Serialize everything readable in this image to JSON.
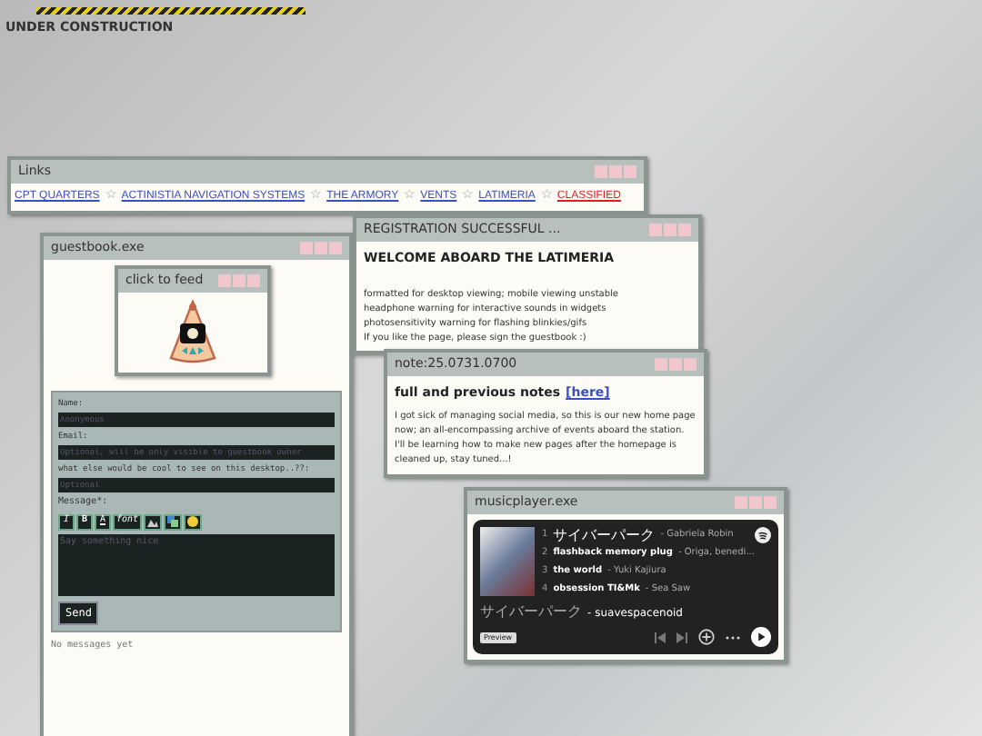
{
  "banner": {
    "text": "UNDER CONSTRUCTION"
  },
  "links_window": {
    "title": "Links",
    "links": [
      {
        "label": "CPT QUARTERS",
        "kind": "normal"
      },
      {
        "label": "ACTINISTIA NAVIGATION SYSTEMS",
        "kind": "normal"
      },
      {
        "label": "THE ARMORY",
        "kind": "normal"
      },
      {
        "label": "VENTS",
        "kind": "normal"
      },
      {
        "label": "LATIMERIA",
        "kind": "normal"
      },
      {
        "label": "CLASSIFIED",
        "kind": "alert"
      }
    ],
    "separator": "☆"
  },
  "guestbook_window": {
    "title": "guestbook.exe",
    "pet_window": {
      "title": "click to feed"
    },
    "form": {
      "fields": [
        {
          "label": "Name:",
          "placeholder": "Anonymous"
        },
        {
          "label": "Email:",
          "placeholder": "Optional, will be only visible to guestbook owner"
        },
        {
          "label": "what else would be cool to see on this desktop..??:",
          "placeholder": "Optional"
        }
      ],
      "message_label": "Message*:",
      "toolbar": [
        {
          "kind": "italic",
          "label": "I"
        },
        {
          "kind": "bold",
          "label": "B"
        },
        {
          "kind": "underline",
          "label": "A"
        },
        {
          "kind": "font",
          "label": "font"
        },
        {
          "kind": "image"
        },
        {
          "kind": "picture"
        },
        {
          "kind": "emoji"
        }
      ],
      "message_placeholder": "Say something nice",
      "send": "Send"
    },
    "empty_note": "No messages yet"
  },
  "registration_window": {
    "title": "REGISTRATION SUCCESSFUL ...",
    "heading": "WELCOME ABOARD THE LATIMERIA",
    "lines": [
      "formatted for desktop viewing; mobile viewing unstable",
      "headphone warning for interactive sounds in widgets",
      "photosensitivity warning for flashing blinkies/gifs",
      "If you like the page, please sign the guestbook :)"
    ]
  },
  "note_window": {
    "title": "note:25.0731.0700",
    "heading": "full and previous notes",
    "link": "[here]",
    "body": "I got sick of managing social media, so this is our new home page now; an all-encompassing archive of events aboard the station. I'll be learning how to make new pages after the homepage is cleaned up, stay tuned...!"
  },
  "music_window": {
    "title": "musicplayer.exe",
    "dash": "-",
    "tracks": [
      {
        "number": "1",
        "title": "サイバーパーク",
        "artist": "Gabriela Robin"
      },
      {
        "number": "2",
        "title": "flashback memory plug",
        "artist": "Origa, benedi..."
      },
      {
        "number": "3",
        "title": "the world",
        "artist": "Yuki Kajiura"
      },
      {
        "number": "4",
        "title": "obsession TI&Mk",
        "artist": "Sea Saw"
      }
    ],
    "now_playing": {
      "title": "サイバーパーク",
      "artist": "suavespacenoid"
    },
    "preview": "Preview"
  }
}
